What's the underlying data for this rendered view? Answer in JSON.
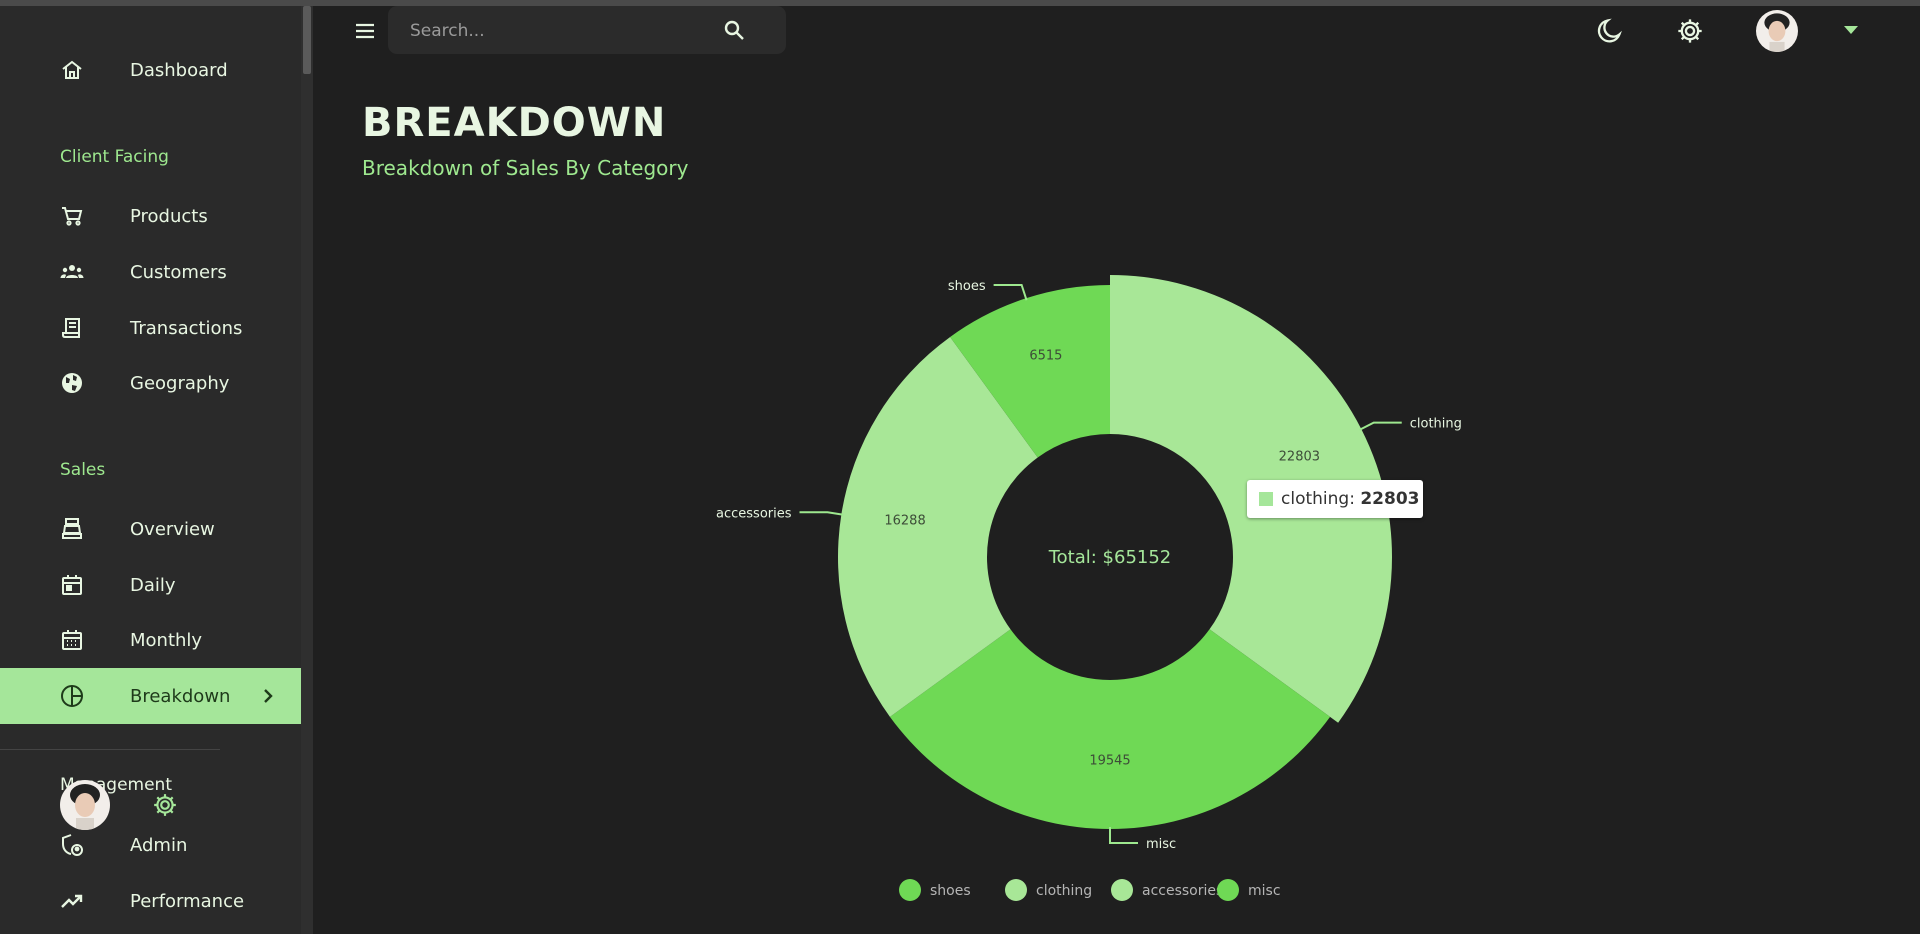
{
  "search": {
    "placeholder": "Search..."
  },
  "sidebar": {
    "items": [
      {
        "label": "Dashboard"
      },
      {
        "label": "Products"
      },
      {
        "label": "Customers"
      },
      {
        "label": "Transactions"
      },
      {
        "label": "Geography"
      },
      {
        "label": "Overview"
      },
      {
        "label": "Daily"
      },
      {
        "label": "Monthly"
      },
      {
        "label": "Breakdown"
      },
      {
        "label": "Admin"
      },
      {
        "label": "Performance"
      }
    ],
    "sections": {
      "client_facing": "Client Facing",
      "sales": "Sales",
      "management": "Management"
    },
    "active_item": "Breakdown"
  },
  "header": {
    "title": "BREAKDOWN",
    "subtitle": "Breakdown of Sales By Category"
  },
  "chart_data": {
    "type": "pie",
    "donut": true,
    "categories": [
      "clothing",
      "misc",
      "accessories",
      "shoes"
    ],
    "values": [
      22803,
      19545,
      16288,
      6515
    ],
    "center_text": "Total: $65152",
    "legend": [
      "shoes",
      "clothing",
      "accessories",
      "misc"
    ],
    "legend_placement": "bottom",
    "tooltip": {
      "label": "clothing:",
      "value": "22803"
    },
    "colors": {
      "clothing": "#a8e797",
      "misc": "#6fd955",
      "accessories": "#a8e797",
      "shoes": "#6fd955"
    }
  },
  "theme": {
    "accent": "#a5e69a",
    "background": "#1f1f1f",
    "sidebar": "#2a2a2a"
  }
}
